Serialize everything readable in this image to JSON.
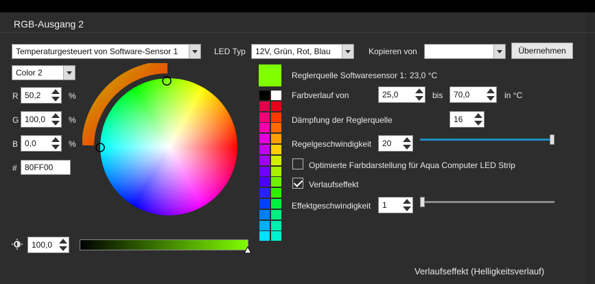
{
  "window": {
    "title": "RGB-Ausgang 2"
  },
  "mode_select": {
    "value": "Temperaturgesteuert von Software-Sensor 1"
  },
  "led_type": {
    "label": "LED Typ",
    "value": "12V, Grün, Rot, Blau"
  },
  "copy": {
    "label": "Kopieren von",
    "value": "",
    "button": "Übernehmen"
  },
  "color_select": {
    "value": "Color 2"
  },
  "rgb": {
    "r": {
      "label": "R",
      "value": "50,2",
      "unit": "%"
    },
    "g": {
      "label": "G",
      "value": "100,0",
      "unit": "%"
    },
    "b": {
      "label": "B",
      "value": "0,0",
      "unit": "%"
    },
    "hex": {
      "label": "#",
      "value": "80FF00"
    }
  },
  "brightness": {
    "value": "100,0",
    "icon": "brightness-icon"
  },
  "selected_color": "#80FF00",
  "palette": [
    [
      "#000000",
      "#FFFFFF"
    ],
    [
      "#E0004A",
      "#E8001A"
    ],
    [
      "#F0007A",
      "#FF3A00"
    ],
    [
      "#F000B0",
      "#FF6A00"
    ],
    [
      "#E000E0",
      "#FFA000"
    ],
    [
      "#C000F0",
      "#FFD000"
    ],
    [
      "#A000FF",
      "#D0F000"
    ],
    [
      "#7000FF",
      "#A8F000"
    ],
    [
      "#4A00FF",
      "#70F000"
    ],
    [
      "#2A20FF",
      "#30F000"
    ],
    [
      "#0040FF",
      "#00F040"
    ],
    [
      "#0080FF",
      "#00F080"
    ],
    [
      "#00B0FF",
      "#00F0B0"
    ],
    [
      "#00E0FF",
      "#00F0D0"
    ]
  ],
  "info": {
    "label": "Reglerquelle Softwaresensor 1:",
    "value": "23,0 °C"
  },
  "gradient": {
    "label": "Farbverlauf von",
    "from": "25,0",
    "to_label": "bis",
    "to": "70,0",
    "unit": "in °C"
  },
  "damping": {
    "label": "Dämpfung der Reglerquelle",
    "value": "16"
  },
  "control_speed": {
    "label": "Regelgeschwindigkeit",
    "value": "20",
    "level": 1.0
  },
  "optimized": {
    "label": "Optimierte Farbdarstellung für Aqua Computer LED Strip",
    "checked": false
  },
  "gradient_effect": {
    "label": "Verlaufseffekt",
    "checked": true
  },
  "effect_speed": {
    "label": "Effektgeschwindigkeit",
    "value": "1",
    "level": 0.0
  },
  "footer": {
    "text": "Verlaufseffekt (Helligkeitsverlauf)"
  },
  "colors": {
    "accent": "#1E8FC8",
    "panel": "#2D2D2D",
    "arc_start": "#FF0000",
    "arc_end": "#C8B400"
  }
}
